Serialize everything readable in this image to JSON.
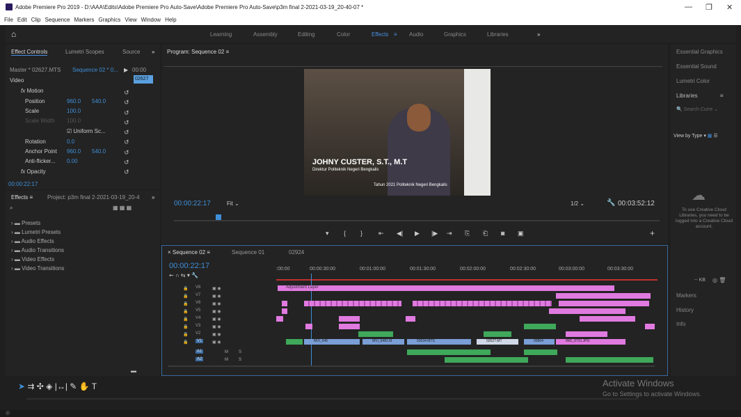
{
  "window": {
    "title": "Adobe Premiere Pro 2019 - D:\\AAA\\Edits\\Adobe Premiere Pro Auto-Save\\Adobe Premiere Pro Auto-Save\\p3m final 2-2021-03-19_20-40-07 *",
    "minimize": "—",
    "maximize": "❐",
    "close": "✕"
  },
  "menu": [
    "File",
    "Edit",
    "Clip",
    "Sequence",
    "Markers",
    "Graphics",
    "View",
    "Window",
    "Help"
  ],
  "workspaces": {
    "tabs": [
      "Learning",
      "Assembly",
      "Editing",
      "Color",
      "Effects",
      "Audio",
      "Graphics",
      "Libraries"
    ],
    "active": "Effects",
    "more": "»"
  },
  "effect_controls": {
    "tabs": [
      "Effect Controls",
      "Lumetri Scopes",
      "Source"
    ],
    "master": "Master * 02627.MTS",
    "sequence": "Sequence 02 * 0...",
    "time_start": "00:00",
    "clip_label": "02627",
    "video_label": "Video",
    "motion": "Motion",
    "position_label": "Position",
    "position_x": "960.0",
    "position_y": "540.0",
    "scale_label": "Scale",
    "scale_value": "100.0",
    "scale_width_label": "Scale Width",
    "scale_width_value": "100.0",
    "uniform_scale": "Uniform Sc...",
    "rotation_label": "Rotation",
    "rotation_value": "0.0",
    "anchor_label": "Anchor Point",
    "anchor_x": "960.0",
    "anchor_y": "540.0",
    "antiflicker_label": "Anti-flicker...",
    "antiflicker_value": "0.00",
    "opacity": "Opacity",
    "timecode": "00:00:22:17"
  },
  "effects_panel": {
    "tab": "Effects",
    "project_tab": "Project: p3m final 2-2021-03-19_20-4",
    "items": [
      "Presets",
      "Lumetri Presets",
      "Audio Effects",
      "Audio Transitions",
      "Video Effects",
      "Video Transitions"
    ]
  },
  "program": {
    "tab": "Program: Sequence 02",
    "timecode": "00:00:22:17",
    "fit": "Fit",
    "resolution": "1/2",
    "duration": "00:03:52:12",
    "lower_third_name": "JOHNY CUSTER, S.T., M.T",
    "lower_third_role": "Direktur Politeknik Negeri Bengkalis",
    "caption": "Tahun 2021 Politeknik Negeri Bengkalis"
  },
  "timeline": {
    "tabs": [
      "Sequence 02",
      "Sequence 01",
      "02924"
    ],
    "timecode": "00:00:22:17",
    "ruler": [
      ":00:00",
      "00:00:30:00",
      "00:01:00:00",
      "00:01:30:00",
      "00:02:00:00",
      "00:02:30:00",
      "00:03:00:00",
      "00:03:30:00"
    ],
    "video_tracks": [
      "V8",
      "V7",
      "V6",
      "V5",
      "V4",
      "V3",
      "V2",
      "V1"
    ],
    "audio_tracks": [
      "A1",
      "A2"
    ],
    "adjustment_layer": "Adjustment Layer",
    "clip_labels": [
      "MVI_646",
      "MVI_6481.M",
      "02634.MTS",
      "02627.MT",
      "00864",
      "IMG_6731.JPG"
    ],
    "mute": "M",
    "solo": "S",
    "colors": {
      "video_clip": "#e07ae0",
      "audio_clip": "#3fa85a",
      "v1_clip": "#7a9ed6"
    }
  },
  "right_panel": {
    "items": [
      "Essential Graphics",
      "Essential Sound",
      "Lumetri Color",
      "Libraries"
    ],
    "search_placeholder": "Search Curre",
    "view_by": "View by Type",
    "cloud_msg": "To use Creative Cloud Libraries, you need to be logged into a Creative Cloud account.",
    "kb": "-- KB",
    "bottom_items": [
      "Markers",
      "History",
      "Info"
    ]
  },
  "activate": {
    "title": "Activate Windows",
    "subtitle": "Go to Settings to activate Windows."
  }
}
